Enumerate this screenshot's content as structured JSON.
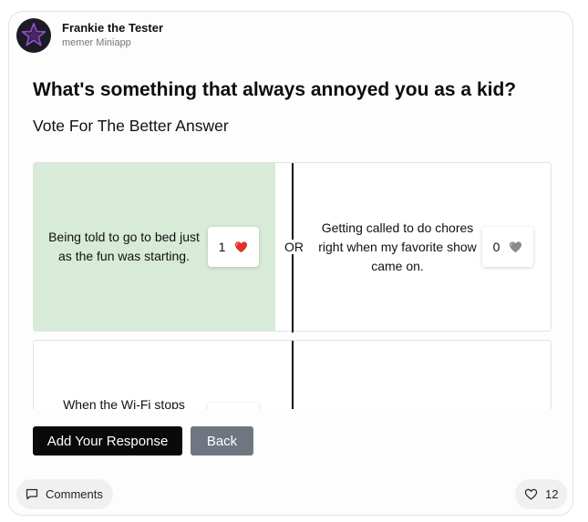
{
  "author": {
    "name": "Frankie the Tester",
    "subtitle": "memer Miniapp"
  },
  "post": {
    "question": "What's something that always annoyed you as a kid?",
    "instruction": "Vote For The Better Answer"
  },
  "pairs": [
    {
      "left": {
        "text": "Being told to go to bed just as the fun was starting.",
        "votes": "1",
        "icon": "heart-red-icon",
        "selected": true
      },
      "separator": "OR",
      "right": {
        "text": "Getting called to do chores right when my favorite show came on.",
        "votes": "0",
        "icon": "heart-gray-icon",
        "selected": false
      }
    },
    {
      "left": {
        "text": "When the Wi-Fi stops"
      }
    }
  ],
  "actions": {
    "add_response": "Add Your Response",
    "back": "Back"
  },
  "footer": {
    "comments": "Comments",
    "likes": "12"
  },
  "colors": {
    "selected_bg": "#d8ead8",
    "heart_red": "#e0312f",
    "heart_gray": "#8a8a8a",
    "primary_btn": "#0a0a0a",
    "secondary_btn": "#707681"
  }
}
